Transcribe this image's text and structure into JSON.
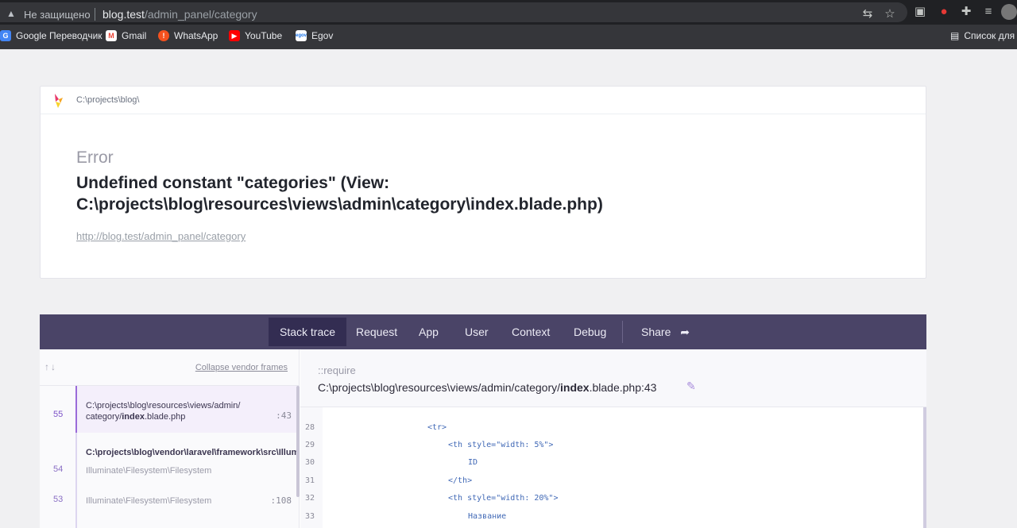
{
  "browser": {
    "security_label": "Не защищено",
    "url_host": "blog.test",
    "url_path": "/admin_panel/category"
  },
  "bookmarks": [
    {
      "label": "Google Переводчик",
      "icon": "google-translate-icon",
      "color": "#4285f4"
    },
    {
      "label": "Gmail",
      "icon": "gmail-icon",
      "color": "#ea4335"
    },
    {
      "label": "WhatsApp",
      "icon": "whatsapp-icon",
      "color": "#f4511e"
    },
    {
      "label": "YouTube",
      "icon": "youtube-icon",
      "color": "#ff0000"
    },
    {
      "label": "Egov",
      "icon": "egov-icon",
      "color": "#ffffff"
    }
  ],
  "reading_list": "Список для ч",
  "card": {
    "path": "C:\\projects\\blog\\",
    "error_type": "Error",
    "error_message": "Undefined constant \"categories\" (View: C:\\projects\\blog\\resources\\views\\admin\\category\\index.blade.php)",
    "url": "http://blog.test/admin_panel/category"
  },
  "tabs": [
    {
      "label": "Stack trace"
    },
    {
      "label": "Request"
    },
    {
      "label": "App"
    },
    {
      "label": "User"
    },
    {
      "label": "Context"
    },
    {
      "label": "Debug"
    },
    {
      "label": "Share"
    }
  ],
  "frames_panel": {
    "arrows": "↑↓",
    "collapse_label": "Collapse vendor frames",
    "frames": [
      {
        "num": "55",
        "line1": "C:\\projects\\blog\\resources\\views/admin/",
        "line2_pre": "category/",
        "line2_bold": "index",
        "line2_post": ".blade.php",
        "line": ":43"
      },
      {
        "group": "C:\\projects\\blog\\vendor\\laravel\\framework\\src\\Illum"
      },
      {
        "num": "54",
        "text": "Illuminate\\Filesystem\\Filesystem",
        "line": ""
      },
      {
        "num": "53",
        "text": "Illuminate\\Filesystem\\Filesystem",
        "line": ":108"
      }
    ]
  },
  "source": {
    "require": "::require",
    "path_pre": "C:\\projects\\blog\\resources\\views/admin/category/",
    "path_bold": "index",
    "path_post": ".blade.php:43",
    "lines": [
      {
        "n": "28",
        "code": "<tr>"
      },
      {
        "n": "29",
        "code": "<th style=\"width: 5%\">"
      },
      {
        "n": "30",
        "code": "ID"
      },
      {
        "n": "31",
        "code": "</th>"
      },
      {
        "n": "32",
        "code": "<th style=\"width: 20%\">"
      },
      {
        "n": "33",
        "code": "Название"
      }
    ]
  }
}
